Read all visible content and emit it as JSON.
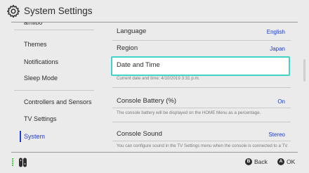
{
  "header": {
    "title": "System Settings",
    "icon": "gear-icon"
  },
  "sidebar": {
    "cut_item": "amiibo",
    "items": [
      {
        "label": "Themes"
      },
      {
        "label": "Notifications"
      },
      {
        "label": "Sleep Mode"
      },
      {
        "label": "Controllers and Sensors"
      },
      {
        "label": "TV Settings"
      },
      {
        "label": "System",
        "active": true
      }
    ]
  },
  "content": {
    "language": {
      "title": "Language",
      "value": "English"
    },
    "region": {
      "title": "Region",
      "value": "Japan"
    },
    "date_time": {
      "title": "Date and Time",
      "desc": "Current date and time: 4/10/2019 3:31 p.m."
    },
    "console_battery": {
      "title": "Console Battery (%)",
      "value": "On",
      "desc": "The console battery will be displayed on the HOME Menu as a percentage."
    },
    "console_sound": {
      "title": "Console Sound",
      "value": "Stereo",
      "desc": "You can configure sound in the TV Settings menu when the console is connected to a TV."
    }
  },
  "footer": {
    "back": {
      "button": "B",
      "label": "Back"
    },
    "ok": {
      "button": "A",
      "label": "OK"
    },
    "controller_icon": "joycon-icon"
  },
  "colors": {
    "accent": "#1e3cd8",
    "focus": "#40d4c6",
    "background": "#ebebeb"
  }
}
